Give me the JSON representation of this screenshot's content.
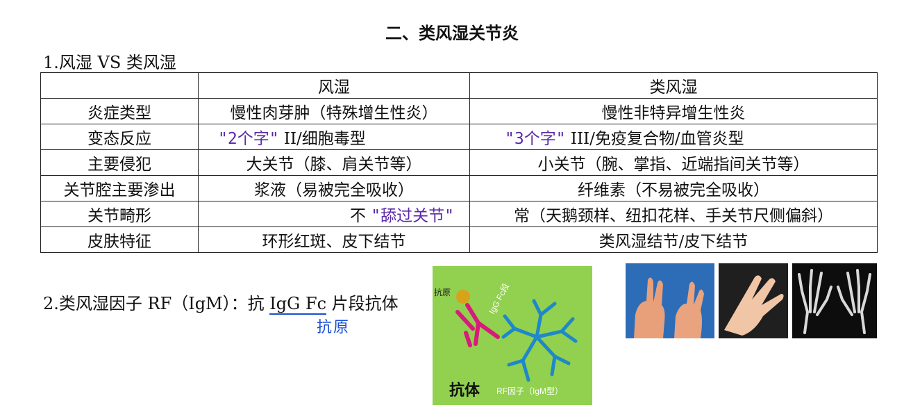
{
  "title": "二、类风湿关节炎",
  "section1": "1.风湿  VS  类风湿",
  "table": {
    "headers": [
      "",
      "风湿",
      "类风湿"
    ],
    "rows": [
      {
        "label": "炎症类型",
        "rh": "慢性肉芽肿（特殊增生性炎）",
        "ra": "慢性非特异增生性炎"
      },
      {
        "label": "变态反应",
        "rh_note": "\"2个字\"",
        "rh": " II/细胞毒型",
        "ra_note": "\"3个字\"",
        "ra": " III/免疫复合物/血管炎型"
      },
      {
        "label": "主要侵犯",
        "rh": "大关节（膝、肩关节等）",
        "ra": "小关节（腕、掌指、近端指间关节等）"
      },
      {
        "label": "关节腔主要渗出",
        "rh": "浆液（易被完全吸收）",
        "ra": "纤维素（不易被完全吸收）"
      },
      {
        "label": "关节畸形",
        "rh": "不 ",
        "rh_note": "\"舔过关节\"",
        "ra": "常（天鹅颈样、纽扣花样、手关节尺侧偏斜）"
      },
      {
        "label": "皮肤特征",
        "rh": "环形红斑、皮下结节",
        "ra": "类风湿结节/皮下结节"
      }
    ]
  },
  "section2": {
    "prefix": "2.类风湿因子 RF（IgM）：抗 ",
    "underlined": "IgG Fc",
    "suffix": " 片段抗体",
    "note": "抗原"
  },
  "diagram": {
    "antigen_label": "抗原",
    "igg_label": "IgG Fc段",
    "antibody_label": "抗体",
    "rf_label": "RF因子（IgM型）"
  },
  "colors": {
    "panel_bg": "#92d050",
    "igg_magenta": "#d81b7a",
    "igm_blue": "#1e88c8",
    "antigen_gold": "#d9a21b",
    "handwriting_purple": "#5b2aa8",
    "handwriting_blue": "#1a4fd0"
  },
  "photos": [
    "hand-deformity-photo",
    "hand-deformity-photo",
    "hand-xray-photo"
  ]
}
